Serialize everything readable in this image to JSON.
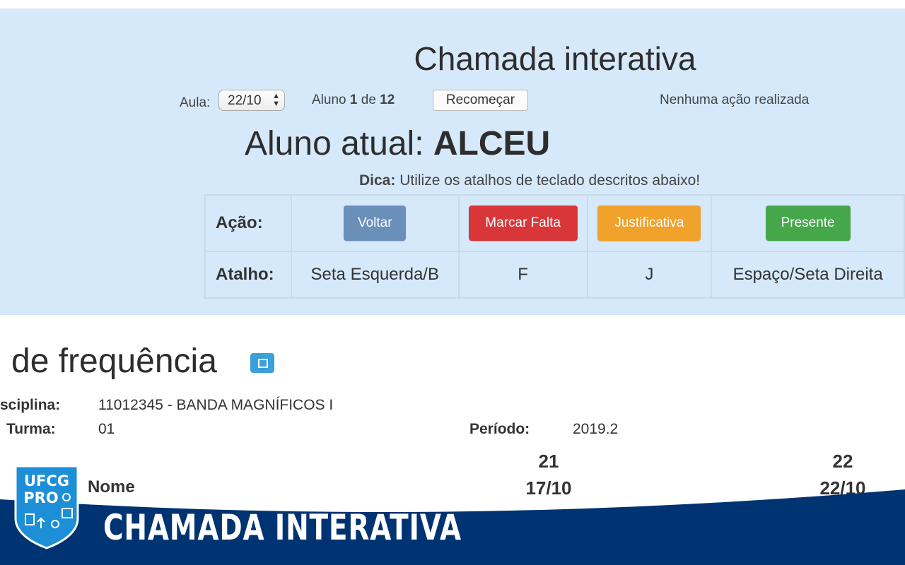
{
  "panel": {
    "title": "Chamada interativa",
    "aula_label": "Aula:",
    "aula_value": "22/10",
    "aluno_prefix": "Aluno",
    "aluno_current": "1",
    "aluno_mid": "de",
    "aluno_total": "12",
    "restart_label": "Recomeçar",
    "status": "Nenhuma ação realizada",
    "current_prefix": "Aluno atual:",
    "current_name": "ALCEU",
    "tip_label": "Dica:",
    "tip_text": "Utilize os atalhos de teclado descritos abaixo!",
    "table": {
      "action_header": "Ação:",
      "shortcut_header": "Atalho:",
      "actions": [
        "Voltar",
        "Marcar Falta",
        "Justificativa",
        "Presente"
      ],
      "shortcuts": [
        "Seta Esquerda/B",
        "F",
        "J",
        "Espaço/Seta Direita"
      ]
    },
    "colors": {
      "panel_bg": "#d6e9fa",
      "voltar": "#6a8fb8",
      "falta": "#d9363a",
      "justificativa": "#f0a22a",
      "presente": "#46a74a"
    }
  },
  "page": {
    "heading": "de frequência",
    "collapse_icon": "collapse-square-icon",
    "disciplina_label": "sciplina:",
    "disciplina_value": "11012345 - BANDA MAGNÍFICOS I",
    "turma_label": "Turma:",
    "turma_value": "01",
    "periodo_label": "Período:",
    "periodo_value": "2019.2",
    "name_header": "Nome",
    "columns": [
      {
        "number": "21",
        "date": "17/10"
      },
      {
        "number": "22",
        "date": "22/10"
      }
    ]
  },
  "banner": {
    "logo_line1": "UFCG",
    "logo_line2": "PRO",
    "text": "CHAMADA INTERATIVA",
    "color": "#003372"
  }
}
